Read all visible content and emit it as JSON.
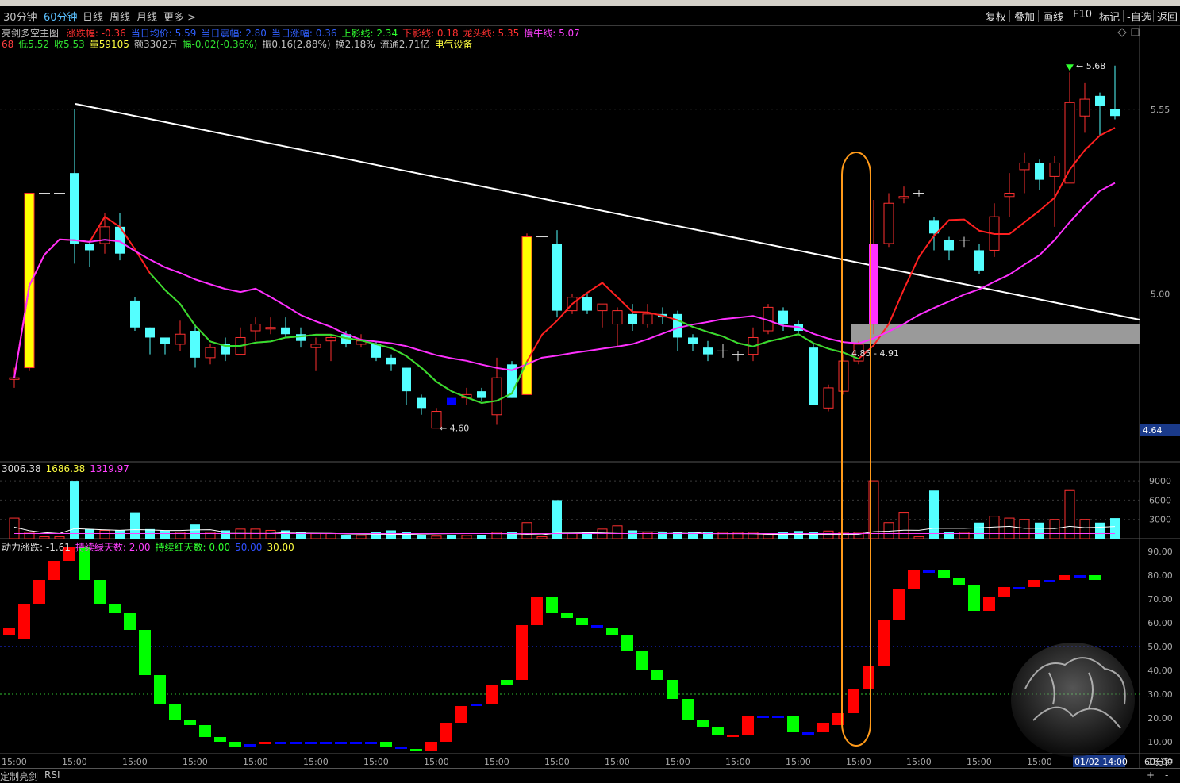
{
  "window": {
    "periods": [
      "30分钟",
      "60分钟",
      "日线",
      "周线",
      "月线",
      "更多 >"
    ],
    "active_period": "60分钟",
    "right_buttons": [
      "复权",
      "叠加",
      "画线",
      "F10",
      "标记",
      "-自选",
      "返回"
    ]
  },
  "main_panel": {
    "title": "亮剑多空主图",
    "indicators": [
      {
        "label": "涨跌幅: -0.36",
        "color": "#ff3030"
      },
      {
        "label": "当日均价: 5.59",
        "color": "#3060ff"
      },
      {
        "label": "当日震幅: 2.80",
        "color": "#3060ff"
      },
      {
        "label": "当日涨幅: 0.36",
        "color": "#3060ff"
      },
      {
        "label": "上影线: 2.34",
        "color": "#30ff30"
      },
      {
        "label": "下影线: 0.18",
        "color": "#ff3030"
      },
      {
        "label": "龙头线: 5.35",
        "color": "#ff3030"
      },
      {
        "label": "慢牛线: 5.07",
        "color": "#ff40ff"
      }
    ],
    "quote_line": [
      {
        "label": "68",
        "color": "#ff4040"
      },
      {
        "label": "低5.52",
        "color": "#30e030"
      },
      {
        "label": "收5.53",
        "color": "#30e030"
      },
      {
        "label": "量59105",
        "color": "#ffff40"
      },
      {
        "label": "额3302万",
        "color": "#c0c0c0"
      },
      {
        "label": "幅-0.02(-0.36%)",
        "color": "#30e030"
      },
      {
        "label": "振0.16(2.88%)",
        "color": "#c0c0c0"
      },
      {
        "label": "换2.18%",
        "color": "#c0c0c0"
      },
      {
        "label": "流通2.71亿",
        "color": "#c0c0c0"
      },
      {
        "label": "电气设备",
        "color": "#ffff40"
      }
    ],
    "y_ticks": [
      "5.55",
      "5.00"
    ],
    "current_price_tag": "4.64",
    "high_label": "5.68",
    "low_label": "4.60",
    "range_label": "4.85 - 4.91"
  },
  "volume_panel": {
    "values_label": [
      {
        "label": "3006.38",
        "color": "#e0e0e0"
      },
      {
        "label": "1686.38",
        "color": "#ffff40"
      },
      {
        "label": "1319.97",
        "color": "#ff40ff"
      }
    ],
    "y_ticks": [
      "9000",
      "6000",
      "3000"
    ]
  },
  "oscillator_panel": {
    "labels": [
      {
        "label": "动力涨跌: -1.61",
        "color": "#e0e0e0"
      },
      {
        "label": "持续绿天数: 2.00",
        "color": "#ff40ff"
      },
      {
        "label": "持续红天数: 0.00",
        "color": "#30ff30"
      },
      {
        "label": "50.00",
        "color": "#3050ff"
      },
      {
        "label": "30.00",
        "color": "#ffff40"
      }
    ],
    "y_ticks": [
      "90.00",
      "80.00",
      "70.00",
      "60.00",
      "50.00",
      "40.00",
      "30.00",
      "20.00",
      "10.00"
    ]
  },
  "time_axis": {
    "labels": [
      "15:00",
      "15:00",
      "15:00",
      "15:00",
      "15:00",
      "15:00",
      "15:00",
      "15:00",
      "15:00",
      "15:00",
      "15:00",
      "15:00",
      "15:00",
      "15:00",
      "15:00",
      "15:00",
      "15:00",
      "15:00",
      "15:00",
      "15:00"
    ],
    "cursor_label": "01/02 14:00",
    "period_label": "60分钟"
  },
  "bottom_tabs": [
    "定制",
    "亮剑",
    "RSI"
  ],
  "chart_data": {
    "type": "candlestick",
    "candles": [
      {
        "o": 4.75,
        "c": 4.75,
        "h": 4.78,
        "l": 4.72,
        "kind": "red"
      },
      {
        "o": 4.78,
        "c": 5.3,
        "h": 5.3,
        "l": 4.77,
        "kind": "yellow"
      },
      {
        "o": 5.3,
        "c": 5.3,
        "h": 5.3,
        "l": 5.3,
        "kind": "dash"
      },
      {
        "o": 5.3,
        "c": 5.3,
        "h": 5.3,
        "l": 5.3,
        "kind": "dash"
      },
      {
        "o": 5.36,
        "c": 5.15,
        "h": 5.55,
        "l": 5.09,
        "kind": "cyan"
      },
      {
        "o": 5.15,
        "c": 5.13,
        "h": 5.16,
        "l": 5.08,
        "kind": "cyan"
      },
      {
        "o": 5.15,
        "c": 5.2,
        "h": 5.24,
        "l": 5.12,
        "kind": "red"
      },
      {
        "o": 5.2,
        "c": 5.12,
        "h": 5.24,
        "l": 5.1,
        "kind": "cyan"
      },
      {
        "o": 4.98,
        "c": 4.9,
        "h": 4.99,
        "l": 4.89,
        "kind": "cyan"
      },
      {
        "o": 4.9,
        "c": 4.87,
        "h": 4.9,
        "l": 4.82,
        "kind": "cyan"
      },
      {
        "o": 4.87,
        "c": 4.85,
        "h": 4.87,
        "l": 4.82,
        "kind": "cyan"
      },
      {
        "o": 4.85,
        "c": 4.88,
        "h": 4.92,
        "l": 4.83,
        "kind": "red"
      },
      {
        "o": 4.89,
        "c": 4.81,
        "h": 4.91,
        "l": 4.78,
        "kind": "cyan"
      },
      {
        "o": 4.81,
        "c": 4.84,
        "h": 4.85,
        "l": 4.79,
        "kind": "red"
      },
      {
        "o": 4.85,
        "c": 4.82,
        "h": 4.87,
        "l": 4.8,
        "kind": "cyan"
      },
      {
        "o": 4.82,
        "c": 4.87,
        "h": 4.9,
        "l": 4.82,
        "kind": "red"
      },
      {
        "o": 4.89,
        "c": 4.91,
        "h": 4.93,
        "l": 4.86,
        "kind": "red"
      },
      {
        "o": 4.9,
        "c": 4.9,
        "h": 4.93,
        "l": 4.88,
        "kind": "red"
      },
      {
        "o": 4.9,
        "c": 4.88,
        "h": 4.93,
        "l": 4.87,
        "kind": "cyan"
      },
      {
        "o": 4.88,
        "c": 4.86,
        "h": 4.9,
        "l": 4.84,
        "kind": "cyan"
      },
      {
        "o": 4.84,
        "c": 4.85,
        "h": 4.87,
        "l": 4.77,
        "kind": "red"
      },
      {
        "o": 4.86,
        "c": 4.87,
        "h": 4.88,
        "l": 4.8,
        "kind": "red"
      },
      {
        "o": 4.88,
        "c": 4.85,
        "h": 4.89,
        "l": 4.84,
        "kind": "cyan"
      },
      {
        "o": 4.85,
        "c": 4.86,
        "h": 4.88,
        "l": 4.84,
        "kind": "red"
      },
      {
        "o": 4.85,
        "c": 4.81,
        "h": 4.86,
        "l": 4.8,
        "kind": "cyan"
      },
      {
        "o": 4.81,
        "c": 4.79,
        "h": 4.82,
        "l": 4.77,
        "kind": "cyan"
      },
      {
        "o": 4.78,
        "c": 4.71,
        "h": 4.78,
        "l": 4.67,
        "kind": "cyan"
      },
      {
        "o": 4.69,
        "c": 4.66,
        "h": 4.7,
        "l": 4.64,
        "kind": "cyan"
      },
      {
        "o": 4.65,
        "c": 4.6,
        "h": 4.66,
        "l": 4.6,
        "kind": "red"
      },
      {
        "o": 4.67,
        "c": 4.69,
        "h": 4.69,
        "l": 4.67,
        "kind": "blue"
      },
      {
        "o": 4.69,
        "c": 4.7,
        "h": 4.72,
        "l": 4.67,
        "kind": "red"
      },
      {
        "o": 4.71,
        "c": 4.69,
        "h": 4.72,
        "l": 4.68,
        "kind": "cyan"
      },
      {
        "o": 4.64,
        "c": 4.75,
        "h": 4.81,
        "l": 4.61,
        "kind": "red"
      },
      {
        "o": 4.69,
        "c": 4.79,
        "h": 4.8,
        "l": 4.69,
        "kind": "cyan"
      },
      {
        "o": 4.7,
        "c": 5.17,
        "h": 5.18,
        "l": 4.7,
        "kind": "yellow"
      },
      {
        "o": 5.17,
        "c": 5.17,
        "h": 5.17,
        "l": 5.17,
        "kind": "dash"
      },
      {
        "o": 5.15,
        "c": 4.95,
        "h": 5.19,
        "l": 4.93,
        "kind": "cyan"
      },
      {
        "o": 4.95,
        "c": 4.99,
        "h": 5.0,
        "l": 4.94,
        "kind": "red"
      },
      {
        "o": 4.99,
        "c": 4.95,
        "h": 5.0,
        "l": 4.94,
        "kind": "cyan"
      },
      {
        "o": 4.95,
        "c": 4.97,
        "h": 4.97,
        "l": 4.9,
        "kind": "red"
      },
      {
        "o": 4.95,
        "c": 4.91,
        "h": 4.96,
        "l": 4.84,
        "kind": "red"
      },
      {
        "o": 4.94,
        "c": 4.91,
        "h": 4.97,
        "l": 4.89,
        "kind": "cyan"
      },
      {
        "o": 4.91,
        "c": 4.94,
        "h": 4.97,
        "l": 4.9,
        "kind": "red"
      },
      {
        "o": 4.94,
        "c": 4.93,
        "h": 4.96,
        "l": 4.91,
        "kind": "cyan"
      },
      {
        "o": 4.94,
        "c": 4.87,
        "h": 4.95,
        "l": 4.83,
        "kind": "cyan"
      },
      {
        "o": 4.87,
        "c": 4.85,
        "h": 4.88,
        "l": 4.83,
        "kind": "cyan"
      },
      {
        "o": 4.84,
        "c": 4.82,
        "h": 4.86,
        "l": 4.8,
        "kind": "cyan"
      },
      {
        "o": 4.83,
        "c": 4.83,
        "h": 4.85,
        "l": 4.81,
        "kind": "dash"
      },
      {
        "o": 4.82,
        "c": 4.82,
        "h": 4.83,
        "l": 4.8,
        "kind": "dash"
      },
      {
        "o": 4.82,
        "c": 4.87,
        "h": 4.9,
        "l": 4.8,
        "kind": "red"
      },
      {
        "o": 4.89,
        "c": 4.96,
        "h": 4.97,
        "l": 4.88,
        "kind": "red"
      },
      {
        "o": 4.95,
        "c": 4.91,
        "h": 4.96,
        "l": 4.89,
        "kind": "cyan"
      },
      {
        "o": 4.91,
        "c": 4.89,
        "h": 4.92,
        "l": 4.88,
        "kind": "cyan"
      },
      {
        "o": 4.84,
        "c": 4.67,
        "h": 4.85,
        "l": 4.67,
        "kind": "cyan"
      },
      {
        "o": 4.66,
        "c": 4.72,
        "h": 4.73,
        "l": 4.65,
        "kind": "red"
      },
      {
        "o": 4.71,
        "c": 4.8,
        "h": 4.82,
        "l": 4.7,
        "kind": "red"
      },
      {
        "o": 4.8,
        "c": 4.85,
        "h": 4.86,
        "l": 4.79,
        "kind": "red"
      },
      {
        "o": 4.91,
        "c": 5.15,
        "h": 5.28,
        "l": 4.88,
        "kind": "magenta"
      },
      {
        "o": 5.15,
        "c": 5.27,
        "h": 5.3,
        "l": 5.14,
        "kind": "red"
      },
      {
        "o": 5.29,
        "c": 5.29,
        "h": 5.32,
        "l": 5.27,
        "kind": "red"
      },
      {
        "o": 5.3,
        "c": 5.3,
        "h": 5.31,
        "l": 5.29,
        "kind": "dash"
      },
      {
        "o": 5.22,
        "c": 5.18,
        "h": 5.23,
        "l": 5.13,
        "kind": "cyan"
      },
      {
        "o": 5.16,
        "c": 5.13,
        "h": 5.17,
        "l": 5.1,
        "kind": "cyan"
      },
      {
        "o": 5.16,
        "c": 5.16,
        "h": 5.17,
        "l": 5.14,
        "kind": "dash"
      },
      {
        "o": 5.13,
        "c": 5.07,
        "h": 5.15,
        "l": 5.06,
        "kind": "cyan"
      },
      {
        "o": 5.13,
        "c": 5.23,
        "h": 5.27,
        "l": 5.11,
        "kind": "red"
      },
      {
        "o": 5.29,
        "c": 5.3,
        "h": 5.36,
        "l": 5.23,
        "kind": "red"
      },
      {
        "o": 5.37,
        "c": 5.39,
        "h": 5.42,
        "l": 5.3,
        "kind": "red"
      },
      {
        "o": 5.39,
        "c": 5.34,
        "h": 5.4,
        "l": 5.31,
        "kind": "cyan"
      },
      {
        "o": 5.35,
        "c": 5.39,
        "h": 5.41,
        "l": 5.2,
        "kind": "red"
      },
      {
        "o": 5.33,
        "c": 5.57,
        "h": 5.66,
        "l": 5.33,
        "kind": "red"
      },
      {
        "o": 5.53,
        "c": 5.58,
        "h": 5.63,
        "l": 5.48,
        "kind": "red"
      },
      {
        "o": 5.59,
        "c": 5.56,
        "h": 5.6,
        "l": 5.47,
        "kind": "cyan"
      },
      {
        "o": 5.55,
        "c": 5.53,
        "h": 5.68,
        "l": 5.52,
        "kind": "cyan"
      }
    ],
    "volume": [
      3.2,
      1.0,
      0.3,
      0.3,
      9.0,
      1.5,
      1.3,
      1.3,
      4.0,
      1.5,
      1.3,
      1.0,
      2.2,
      1.0,
      1.3,
      1.5,
      1.5,
      1.3,
      1.3,
      1.0,
      0.8,
      0.8,
      0.5,
      0.5,
      1.0,
      1.3,
      1.0,
      0.5,
      0.4,
      0.6,
      0.5,
      0.5,
      1.0,
      1.0,
      2.5,
      0.3,
      6.0,
      0.8,
      1.0,
      1.5,
      2.0,
      1.3,
      1.0,
      1.0,
      1.0,
      1.0,
      1.0,
      1.0,
      1.0,
      1.0,
      0.6,
      1.0,
      1.2,
      1.0,
      1.2,
      1.0,
      1.0,
      9.0,
      2.5,
      4.0,
      0.3,
      7.5,
      1.0,
      1.0,
      2.5,
      3.5,
      3.2,
      3.0,
      2.5,
      3.0,
      7.5,
      3.0,
      2.5,
      3.2
    ]
  }
}
